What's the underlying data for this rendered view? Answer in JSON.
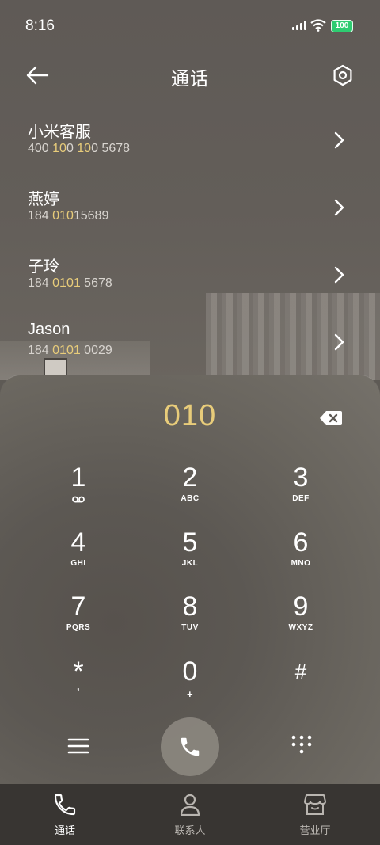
{
  "status": {
    "time": "8:16",
    "battery": "100"
  },
  "header": {
    "title": "通话"
  },
  "contacts": [
    {
      "name": "小米客服",
      "num_parts": [
        "400 ",
        "10",
        "0 ",
        "10",
        "0 5678"
      ]
    },
    {
      "name": "燕婷",
      "num_parts": [
        "184 ",
        "010",
        "15689"
      ]
    },
    {
      "name": "子玲",
      "num_parts": [
        "184 ",
        "0101",
        " 5678"
      ]
    },
    {
      "name": "Jason",
      "num_parts": [
        "184 ",
        "0101",
        " 0029"
      ]
    }
  ],
  "dialer": {
    "input": "010",
    "keys": [
      {
        "digit": "1",
        "sub": "voicemail"
      },
      {
        "digit": "2",
        "sub": "ABC"
      },
      {
        "digit": "3",
        "sub": "DEF"
      },
      {
        "digit": "4",
        "sub": "GHI"
      },
      {
        "digit": "5",
        "sub": "JKL"
      },
      {
        "digit": "6",
        "sub": "MNO"
      },
      {
        "digit": "7",
        "sub": "PQRS"
      },
      {
        "digit": "8",
        "sub": "TUV"
      },
      {
        "digit": "9",
        "sub": "WXYZ"
      },
      {
        "digit": "*",
        "sub": ","
      },
      {
        "digit": "0",
        "sub": "+"
      },
      {
        "digit": "#",
        "sub": ""
      }
    ]
  },
  "tabs": [
    {
      "label": "通话",
      "icon": "phone-icon",
      "active": true
    },
    {
      "label": "联系人",
      "icon": "person-icon",
      "active": false
    },
    {
      "label": "营业厅",
      "icon": "store-icon",
      "active": false
    }
  ],
  "colors": {
    "highlight": "#e8cc7a",
    "battery": "#2ecc71"
  }
}
